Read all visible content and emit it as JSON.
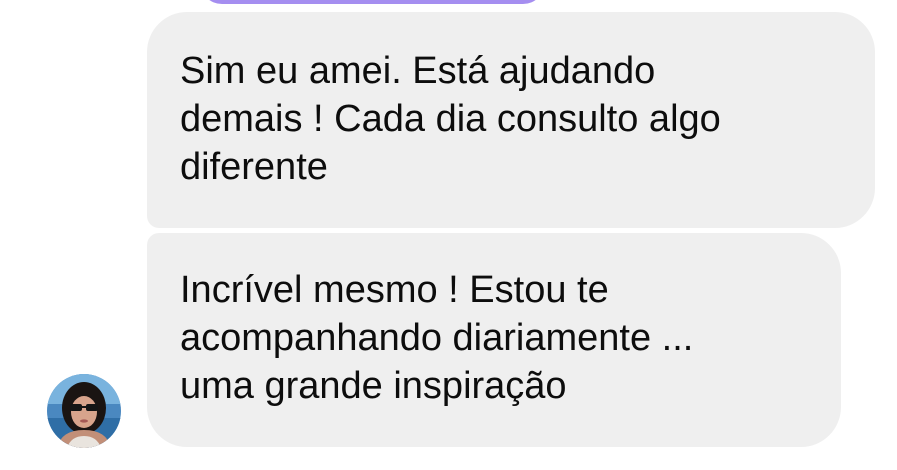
{
  "chat": {
    "messages": [
      {
        "text": "Sim eu amei. Está ajudando\ndemais ! Cada dia consulto algo\ndiferente"
      },
      {
        "text": "Incrível mesmo ! Estou te\nacompanhando diariamente ...\numa grande inspiração"
      }
    ],
    "sender_avatar": {
      "icon": "profile-photo"
    }
  },
  "colors": {
    "incoming_bubble": "#efefef",
    "outgoing_bubble_edge": "#a58ef0",
    "text": "#0d0d0d"
  }
}
